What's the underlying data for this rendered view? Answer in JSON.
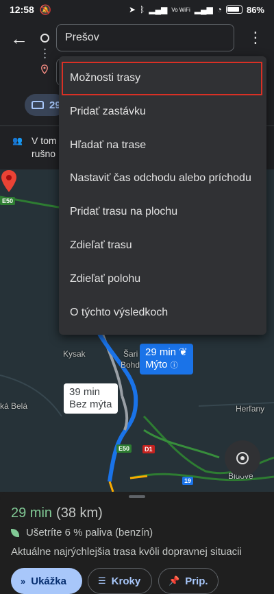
{
  "status_bar": {
    "time": "12:58",
    "network_label": "Vo WiFi",
    "battery": "86%"
  },
  "header": {
    "origin_placeholder": "Prešov",
    "destination_value": "",
    "travel_mode_time": "29"
  },
  "info_strip": {
    "text_line1": "V tom",
    "text_line2": "rušno"
  },
  "menu": {
    "items": [
      "Možnosti trasy",
      "Pridať zastávku",
      "Hľadať na trase",
      "Nastaviť čas odchodu alebo príchodu",
      "Pridať trasu na plochu",
      "Zdieľať trasu",
      "Zdieľať polohu",
      "O týchto výsledkoch"
    ],
    "highlighted_index": 0
  },
  "map": {
    "labels": {
      "kysak": "Kysak",
      "sari": "Šari",
      "bohda": "Bohda",
      "ka_bela": "ká Belá",
      "herlany": "Herľany",
      "bidove": "Bidove"
    },
    "roads": {
      "e50_top": "E50",
      "e50": "E50",
      "d1": "D1",
      "r19": "19"
    },
    "fast_route": {
      "time": "29 min",
      "toll": "Mýto"
    },
    "alt_route": {
      "time": "39 min",
      "toll": "Bez mýta"
    },
    "colors": {
      "route_primary": "#1a73e8",
      "route_alt": "#9aa0a6",
      "highway": "#34a853",
      "pin": "#ea4335"
    }
  },
  "sheet": {
    "eta_minutes": "29 min",
    "distance": "(38 km)",
    "fuel_text": "Ušetríte 6 % paliva (benzín)",
    "description": "Aktuálne najrýchlejšia trasa kvôli dopravnej situacii",
    "buttons": {
      "preview": "Ukážka",
      "steps": "Kroky",
      "pin": "Prip."
    }
  }
}
